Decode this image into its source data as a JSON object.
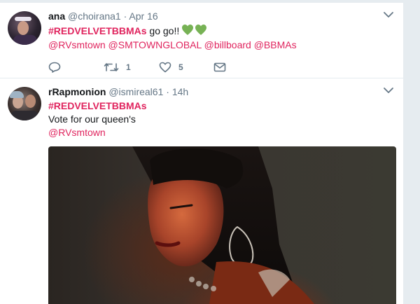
{
  "tweets": [
    {
      "name": "ana",
      "handle": "@choirana1",
      "separator": "·",
      "time": "Apr 16",
      "hashtag": "#REDVELVETBBMAs",
      "text_after": " go go!!",
      "mentions": [
        "@RVsmtown",
        "@SMTOWNGLOBAL",
        "@billboard",
        "@BBMAs"
      ],
      "retweet_count": "1",
      "like_count": "5"
    },
    {
      "name": "rRapmonion",
      "handle": "@ismireal61",
      "separator": "·",
      "time": "14h",
      "hashtag": "#REDVELVETBBMAs",
      "line2": "Vote for our queen's",
      "mention": "@RVsmtown"
    }
  ],
  "icons": {
    "reply": "reply-icon",
    "retweet": "retweet-icon",
    "like": "heart-icon",
    "dm": "envelope-icon",
    "caret": "chevron-down-icon",
    "emoji": "green-heart-emoji"
  },
  "colors": {
    "hashtag": "#e0245e",
    "secondary": "#657786",
    "text": "#14171a",
    "emoji_heart": "#77b255"
  }
}
